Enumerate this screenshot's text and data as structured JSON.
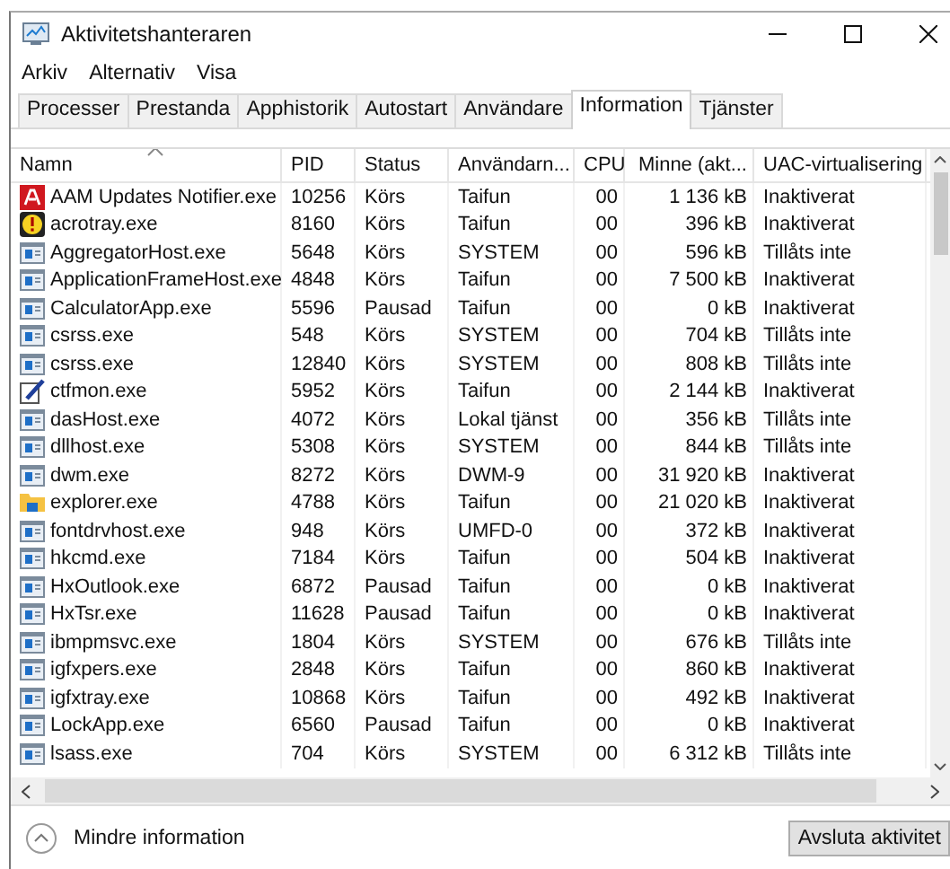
{
  "window": {
    "title": "Aktivitetshanteraren"
  },
  "menu": [
    "Arkiv",
    "Alternativ",
    "Visa"
  ],
  "tabs": [
    {
      "label": "Processer",
      "selected": false
    },
    {
      "label": "Prestanda",
      "selected": false
    },
    {
      "label": "Apphistorik",
      "selected": false
    },
    {
      "label": "Autostart",
      "selected": false
    },
    {
      "label": "Användare",
      "selected": false
    },
    {
      "label": "Information",
      "selected": true
    },
    {
      "label": "Tjänster",
      "selected": false
    }
  ],
  "table": {
    "columns": [
      {
        "label": "Namn",
        "sorted": true
      },
      {
        "label": "PID",
        "sorted": false
      },
      {
        "label": "Status",
        "sorted": false
      },
      {
        "label": "Användarn...",
        "sorted": false
      },
      {
        "label": "CPU",
        "sorted": false
      },
      {
        "label": "Minne (akt...",
        "sorted": false
      },
      {
        "label": "UAC-virtualisering",
        "sorted": false
      }
    ],
    "rows": [
      {
        "kind": "adobe",
        "cells": [
          "AAM Updates Notifier.exe",
          "10256",
          "Körs",
          "Taifun",
          "00",
          "1 136 kB",
          "Inaktiverat"
        ]
      },
      {
        "kind": "warning",
        "cells": [
          "acrotray.exe",
          "8160",
          "Körs",
          "Taifun",
          "00",
          "396 kB",
          "Inaktiverat"
        ]
      },
      {
        "kind": "app",
        "cells": [
          "AggregatorHost.exe",
          "5648",
          "Körs",
          "SYSTEM",
          "00",
          "596 kB",
          "Tillåts inte"
        ]
      },
      {
        "kind": "app",
        "cells": [
          "ApplicationFrameHost.exe",
          "4848",
          "Körs",
          "Taifun",
          "00",
          "7 500 kB",
          "Inaktiverat"
        ]
      },
      {
        "kind": "app",
        "cells": [
          "CalculatorApp.exe",
          "5596",
          "Pausad",
          "Taifun",
          "00",
          "0 kB",
          "Inaktiverat"
        ]
      },
      {
        "kind": "app",
        "cells": [
          "csrss.exe",
          "548",
          "Körs",
          "SYSTEM",
          "00",
          "704 kB",
          "Tillåts inte"
        ]
      },
      {
        "kind": "app",
        "cells": [
          "csrss.exe",
          "12840",
          "Körs",
          "SYSTEM",
          "00",
          "808 kB",
          "Tillåts inte"
        ]
      },
      {
        "kind": "pen",
        "cells": [
          "ctfmon.exe",
          "5952",
          "Körs",
          "Taifun",
          "00",
          "2 144 kB",
          "Inaktiverat"
        ]
      },
      {
        "kind": "app",
        "cells": [
          "dasHost.exe",
          "4072",
          "Körs",
          "Lokal tjänst",
          "00",
          "356 kB",
          "Tillåts inte"
        ]
      },
      {
        "kind": "app",
        "cells": [
          "dllhost.exe",
          "5308",
          "Körs",
          "SYSTEM",
          "00",
          "844 kB",
          "Tillåts inte"
        ]
      },
      {
        "kind": "app",
        "cells": [
          "dwm.exe",
          "8272",
          "Körs",
          "DWM-9",
          "00",
          "31 920 kB",
          "Inaktiverat"
        ]
      },
      {
        "kind": "folder",
        "cells": [
          "explorer.exe",
          "4788",
          "Körs",
          "Taifun",
          "00",
          "21 020 kB",
          "Inaktiverat"
        ]
      },
      {
        "kind": "app",
        "cells": [
          "fontdrvhost.exe",
          "948",
          "Körs",
          "UMFD-0",
          "00",
          "372 kB",
          "Inaktiverat"
        ]
      },
      {
        "kind": "app",
        "cells": [
          "hkcmd.exe",
          "7184",
          "Körs",
          "Taifun",
          "00",
          "504 kB",
          "Inaktiverat"
        ]
      },
      {
        "kind": "app",
        "cells": [
          "HxOutlook.exe",
          "6872",
          "Pausad",
          "Taifun",
          "00",
          "0 kB",
          "Inaktiverat"
        ]
      },
      {
        "kind": "app",
        "cells": [
          "HxTsr.exe",
          "11628",
          "Pausad",
          "Taifun",
          "00",
          "0 kB",
          "Inaktiverat"
        ]
      },
      {
        "kind": "app",
        "cells": [
          "ibmpmsvc.exe",
          "1804",
          "Körs",
          "SYSTEM",
          "00",
          "676 kB",
          "Tillåts inte"
        ]
      },
      {
        "kind": "app",
        "cells": [
          "igfxpers.exe",
          "2848",
          "Körs",
          "Taifun",
          "00",
          "860 kB",
          "Inaktiverat"
        ]
      },
      {
        "kind": "app",
        "cells": [
          "igfxtray.exe",
          "10868",
          "Körs",
          "Taifun",
          "00",
          "492 kB",
          "Inaktiverat"
        ]
      },
      {
        "kind": "app",
        "cells": [
          "LockApp.exe",
          "6560",
          "Pausad",
          "Taifun",
          "00",
          "0 kB",
          "Inaktiverat"
        ]
      },
      {
        "kind": "app",
        "cells": [
          "lsass.exe",
          "704",
          "Körs",
          "SYSTEM",
          "00",
          "6 312 kB",
          "Tillåts inte"
        ]
      }
    ]
  },
  "footer": {
    "toggle": "Mindre information",
    "button": "Avsluta aktivitet"
  }
}
